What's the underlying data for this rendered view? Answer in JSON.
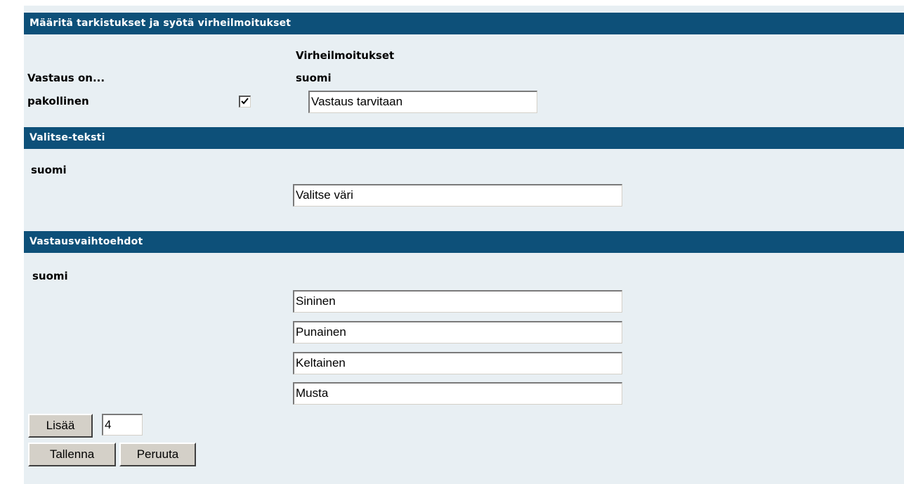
{
  "validation": {
    "header": "Määritä tarkistukset ja syötä virheilmoitukset",
    "errors_heading": "Virheilmoitukset",
    "language": "suomi",
    "answer_is": "Vastaus on...",
    "required_label": "pakollinen",
    "required_checked": true,
    "required_error_value": "Vastaus tarvitaan"
  },
  "select_text": {
    "header": "Valitse-teksti",
    "language": "suomi",
    "value": "Valitse väri"
  },
  "options": {
    "header": "Vastausvaihtoehdot",
    "language": "suomi",
    "values": [
      "Sininen",
      "Punainen",
      "Keltainen",
      "Musta"
    ]
  },
  "actions": {
    "add_label": "Lisää",
    "add_count": "4",
    "save_label": "Tallenna",
    "cancel_label": "Peruuta"
  },
  "colors": {
    "header_bg": "#0d5079",
    "panel_bg": "#e8eff3",
    "button_bg": "#d4d0c8"
  }
}
